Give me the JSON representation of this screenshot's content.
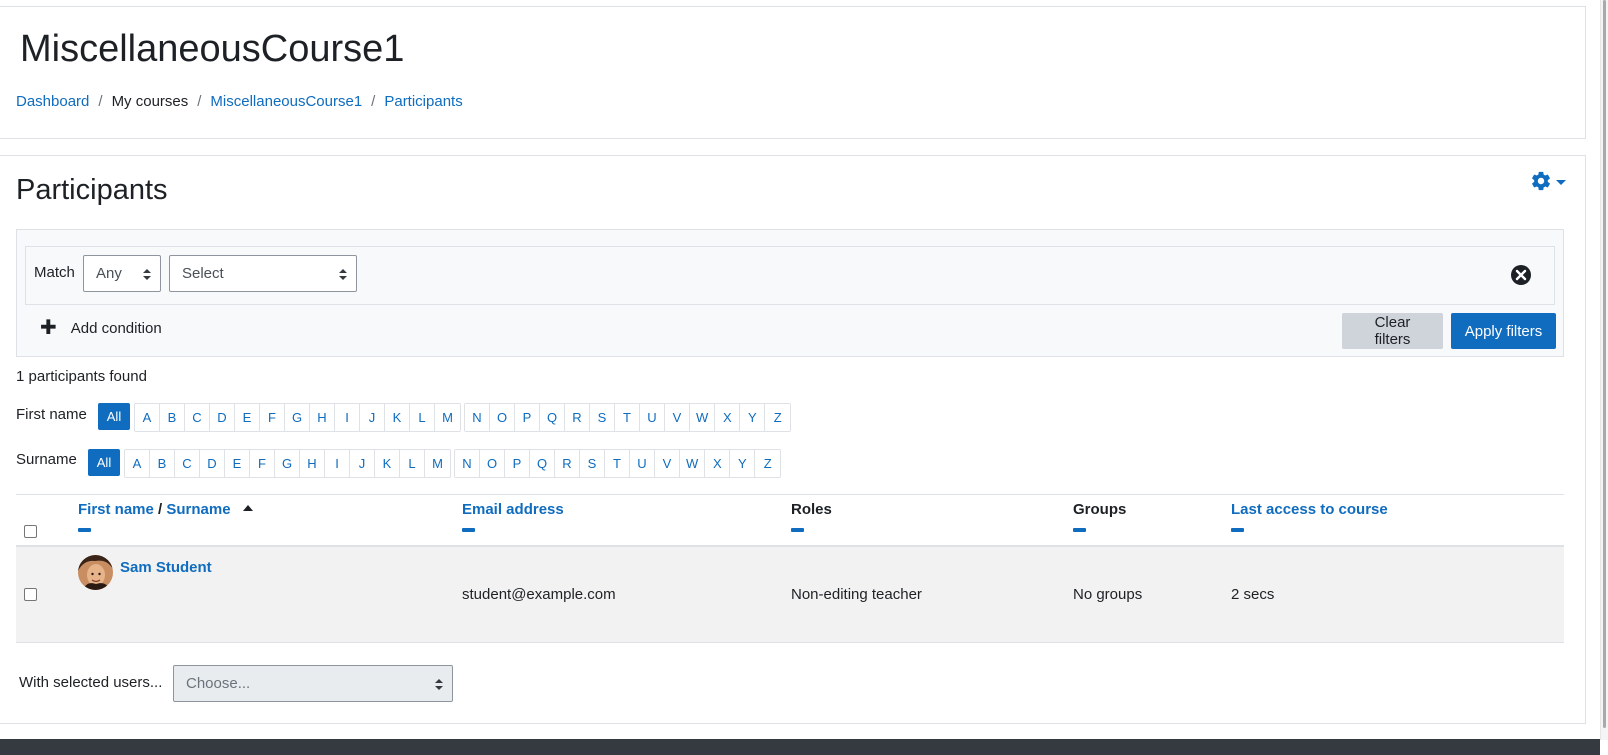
{
  "course": {
    "title": "MiscellaneousCourse1"
  },
  "breadcrumb": [
    {
      "label": "Dashboard",
      "link": true
    },
    {
      "label": "My courses",
      "link": false
    },
    {
      "label": "MiscellaneousCourse1",
      "link": true
    },
    {
      "label": "Participants",
      "link": true
    }
  ],
  "page": {
    "title": "Participants",
    "gear_icon": "gear-icon"
  },
  "filters": {
    "match_label": "Match",
    "match_value": "Any",
    "condition_placeholder": "Select",
    "add_condition_label": "Add condition",
    "clear_label": "Clear filters",
    "apply_label": "Apply filters"
  },
  "result_count": "1 participants found",
  "initials": {
    "first_name_label": "First name",
    "surname_label": "Surname",
    "all_label": "All",
    "letters_a_m": [
      "A",
      "B",
      "C",
      "D",
      "E",
      "F",
      "G",
      "H",
      "I",
      "J",
      "K",
      "L",
      "M"
    ],
    "letters_n_z": [
      "N",
      "O",
      "P",
      "Q",
      "R",
      "S",
      "T",
      "U",
      "V",
      "W",
      "X",
      "Y",
      "Z"
    ]
  },
  "table": {
    "headers": {
      "first_name": "First name",
      "separator": "/",
      "surname": "Surname",
      "email": "Email address",
      "roles": "Roles",
      "groups": "Groups",
      "last_access": "Last access to course"
    },
    "rows": [
      {
        "name": "Sam Student",
        "email": "student@example.com",
        "roles": "Non-editing teacher",
        "groups": "No groups",
        "last_access": "2 secs"
      }
    ]
  },
  "bulk": {
    "label": "With selected users...",
    "placeholder": "Choose..."
  },
  "colors": {
    "accent": "#0f6cbf",
    "footer": "#343a40",
    "row_bg": "#f2f2f2"
  }
}
